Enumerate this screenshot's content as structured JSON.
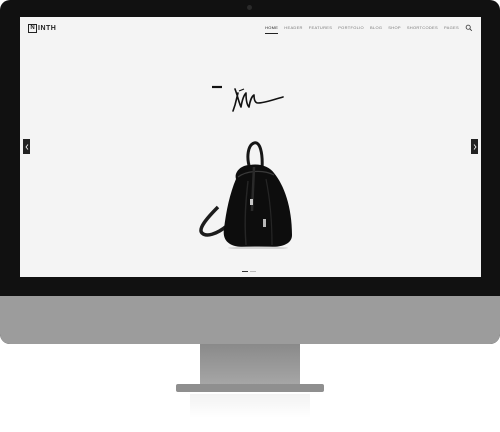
{
  "site": {
    "logo_letter": "N",
    "logo_text": "INTH"
  },
  "nav": {
    "items": [
      {
        "label": "HOME",
        "active": true
      },
      {
        "label": "HEADER",
        "active": false
      },
      {
        "label": "FEATURES",
        "active": false
      },
      {
        "label": "PORTFOLIO",
        "active": false
      },
      {
        "label": "BLOG",
        "active": false
      },
      {
        "label": "SHOP",
        "active": false
      },
      {
        "label": "SHORTCODES",
        "active": false
      },
      {
        "label": "PAGES",
        "active": false
      }
    ]
  },
  "slider": {
    "slide_count": 2,
    "active_slide": 1
  },
  "icons": {
    "search": "search-icon",
    "prev": "chevron-left-icon",
    "next": "chevron-right-icon"
  },
  "colors": {
    "screen_bg": "#f4f4f4",
    "bezel": "#111111",
    "chin": "#9c9c9c",
    "text": "#222222"
  }
}
